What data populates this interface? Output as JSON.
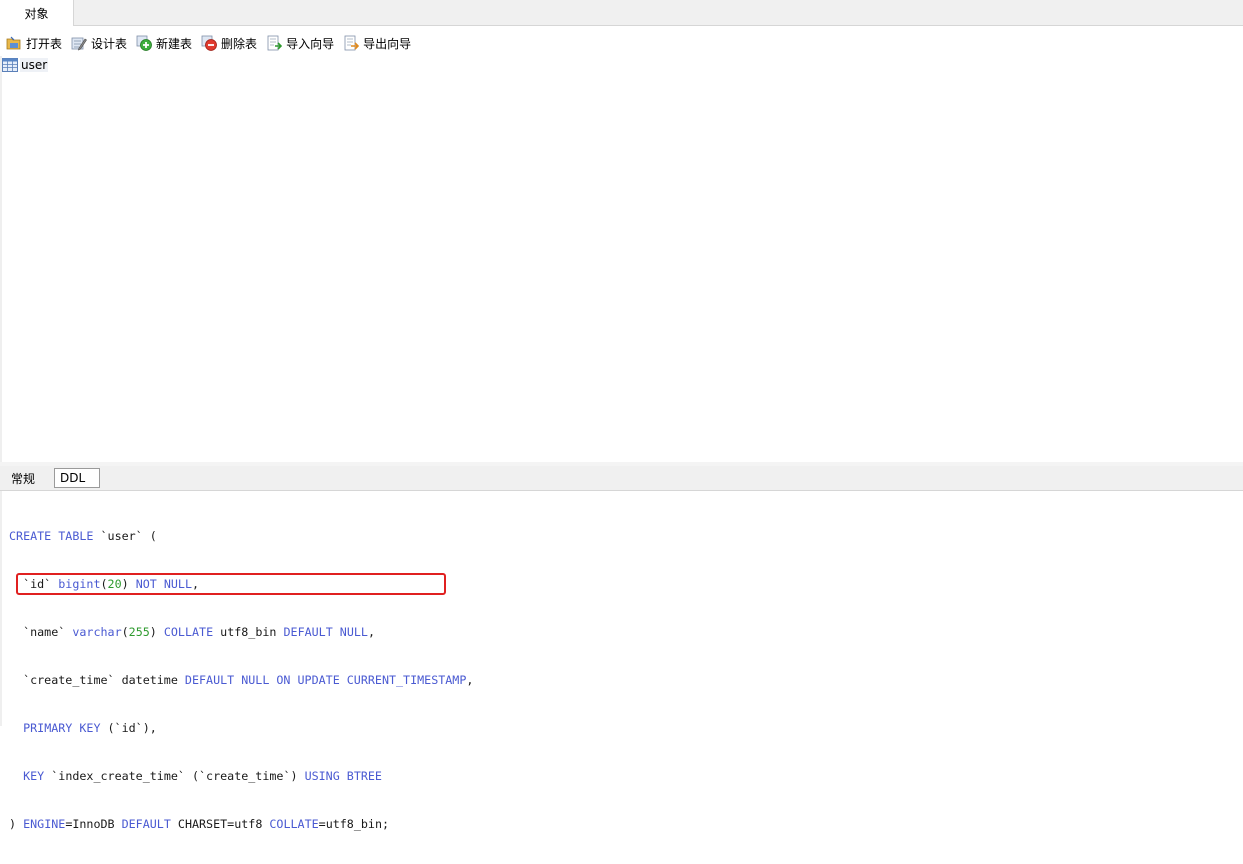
{
  "tabs": {
    "objects_tab": "对象"
  },
  "toolbar": {
    "open_table": "打开表",
    "design_table": "设计表",
    "new_table": "新建表",
    "delete_table": "删除表",
    "import_wizard": "导入向导",
    "export_wizard": "导出向导"
  },
  "objects": {
    "items": [
      {
        "label": "user"
      }
    ]
  },
  "subtabs": {
    "general": "常规",
    "ddl": "DDL"
  },
  "ddl": {
    "line1": {
      "kw1": "CREATE TABLE",
      "rest": " `user` ("
    },
    "line2": {
      "pre": "  `id` ",
      "kw1": "bigint",
      "p1": "(",
      "n1": "20",
      "p2": ") ",
      "kw2": "NOT NULL",
      "post": ","
    },
    "line3": {
      "pre": "  `name` ",
      "kw1": "varchar",
      "p1": "(",
      "n1": "255",
      "p2": ") ",
      "kw2": "COLLATE",
      "mid": " utf8_bin ",
      "kw3": "DEFAULT NULL",
      "post": ","
    },
    "line4": {
      "pre": "  `create_time` datetime ",
      "kw1": "DEFAULT NULL ON UPDATE CURRENT_TIMESTAMP",
      "post": ","
    },
    "line5": {
      "pre": "  ",
      "kw1": "PRIMARY KEY",
      "post": " (`id`),"
    },
    "line6": {
      "pre": "  ",
      "kw1": "KEY",
      "mid": " `index_create_time` (`create_time`) ",
      "kw2": "USING BTREE"
    },
    "line7": {
      "pre": ") ",
      "kw1": "ENGINE",
      "p1": "=InnoDB ",
      "kw2": "DEFAULT",
      "mid": " CHARSET=utf8 ",
      "kw3": "COLLATE",
      "post": "=utf8_bin;"
    }
  },
  "colors": {
    "keyword": "#4a5ad2",
    "number": "#2e9a2e",
    "highlight": "#e02020"
  }
}
